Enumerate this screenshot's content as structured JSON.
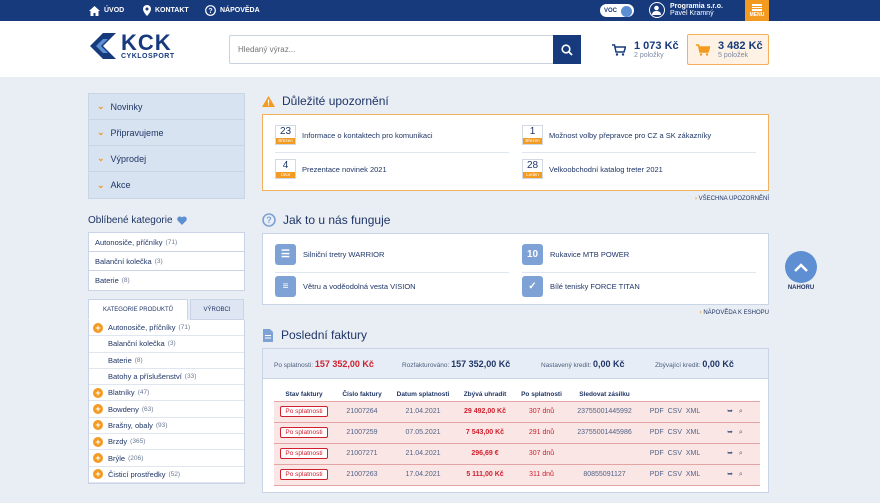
{
  "topbar": {
    "home_label": "ÚVOD",
    "contact_label": "KONTAKT",
    "help_label": "NÁPOVĚDA",
    "voc_label": "VOC",
    "company": "Programia s.r.o.",
    "user": "Pavel Kramný",
    "menu_label": "MENU"
  },
  "header": {
    "logo_main": "KCK",
    "logo_sub": "CYKLOSPORT",
    "search_placeholder": "Hledaný výraz...",
    "cart1_price": "1 073 Kč",
    "cart1_items": "2 položky",
    "cart2_price": "3 482 Kč",
    "cart2_items": "5 položek"
  },
  "sidebar": {
    "nav": [
      "Novinky",
      "Připravujeme",
      "Výprodej",
      "Akce"
    ],
    "favorites_title": "Oblíbené kategorie",
    "favorites": [
      {
        "name": "Autonosiče, příčníky",
        "count": "(71)"
      },
      {
        "name": "Balanční kolečka",
        "count": "(3)"
      },
      {
        "name": "Baterie",
        "count": "(8)"
      }
    ],
    "tab_products": "KATEGORIE PRODUKTŮ",
    "tab_makers": "VÝROBCI",
    "categories": [
      {
        "name": "Autonosiče, příčníky",
        "count": "(71)",
        "expandable": true
      },
      {
        "name": "Balanční kolečka",
        "count": "(3)",
        "expandable": false
      },
      {
        "name": "Baterie",
        "count": "(8)",
        "expandable": false
      },
      {
        "name": "Batohy a příslušenství",
        "count": "(33)",
        "expandable": false
      },
      {
        "name": "Blatníky",
        "count": "(47)",
        "expandable": true
      },
      {
        "name": "Bowdeny",
        "count": "(63)",
        "expandable": true
      },
      {
        "name": "Brašny, obaly",
        "count": "(93)",
        "expandable": true
      },
      {
        "name": "Brzdy",
        "count": "(365)",
        "expandable": true
      },
      {
        "name": "Brýle",
        "count": "(206)",
        "expandable": true
      },
      {
        "name": "Čisticí prostředky",
        "count": "(52)",
        "expandable": true
      }
    ]
  },
  "notices": {
    "title": "Důležité upozornění",
    "items": [
      {
        "day": "23",
        "month": "Březen",
        "text": "Informace o kontaktech pro komunikaci"
      },
      {
        "day": "1",
        "month": "Březen",
        "text": "Možnost volby přepravce pro CZ a SK zákazníky"
      },
      {
        "day": "4",
        "month": "Únor",
        "text": "Prezentace novinek 2021"
      },
      {
        "day": "28",
        "month": "Leden",
        "text": "Velkoobchodní katalog treter 2021"
      }
    ],
    "more": "VŠECHNA UPOZORNĚNÍ"
  },
  "howto": {
    "title": "Jak to u nás funguje",
    "items": [
      {
        "text": "Silniční tretry WARRIOR",
        "icon": "sliders-icon"
      },
      {
        "text": "Rukavice MTB POWER",
        "icon": "number-10-icon"
      },
      {
        "text": "Větru a voděodolná vesta VISION",
        "icon": "list-add-icon"
      },
      {
        "text": "Bílé tenisky FORCE TITAN",
        "icon": "cart-check-icon"
      }
    ],
    "more": "NÁPOVĚDA K ESHOPU"
  },
  "invoices": {
    "title": "Poslední faktury",
    "summary": {
      "overdue_label": "Po splatnosti:",
      "overdue_value": "157 352,00 Kč",
      "invoiced_label": "Rozfakturováno:",
      "invoiced_value": "157 352,00 Kč",
      "credit_label": "Nastavený kredit:",
      "credit_value": "0,00 Kč",
      "remaining_label": "Zbývající kredit:",
      "remaining_value": "0,00 Kč"
    },
    "headers": [
      "Stav faktury",
      "Číslo faktury",
      "Datum splatnosti",
      "Zbývá uhradit",
      "Po splatnosti",
      "Sledovat zásilku",
      "",
      ""
    ],
    "rows": [
      {
        "status": "Po splatnosti",
        "number": "21007264",
        "date": "21.04.2021",
        "remaining": "29 492,00 Kč",
        "overdue": "307 dnů",
        "tracking": "23755001445992"
      },
      {
        "status": "Po splatnosti",
        "number": "21007259",
        "date": "07.05.2021",
        "remaining": "7 543,00 Kč",
        "overdue": "291 dnů",
        "tracking": "23755001445986"
      },
      {
        "status": "Po splatnosti",
        "number": "21007271",
        "date": "21.04.2021",
        "remaining": "296,69 €",
        "overdue": "307 dnů",
        "tracking": ""
      },
      {
        "status": "Po splatnosti",
        "number": "21007263",
        "date": "17.04.2021",
        "remaining": "5 111,00 Kč",
        "overdue": "311 dnů",
        "tracking": "80855091127"
      }
    ],
    "pdf": "PDF",
    "csv": "CSV",
    "xml": "XML"
  },
  "back_to_top": "NAHORU",
  "colors": {
    "navy": "#173a7d",
    "orange": "#f39a21",
    "red": "#d0202e"
  }
}
